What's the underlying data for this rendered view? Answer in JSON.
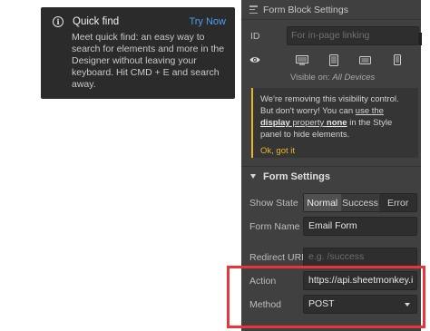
{
  "quick_find": {
    "title": "Quick find",
    "try_now": "Try Now",
    "body": "Meet quick find: an easy way to search for elements and more in the Designer without leaving your keyboard. Hit CMD + E and search away."
  },
  "panel": {
    "header_title": "Form Block Settings",
    "id_label": "ID",
    "id_placeholder": "For in-page linking",
    "visible_on_prefix": "Visible on:",
    "visible_on_value": "All Devices",
    "notice": {
      "text_1": "We're removing this visibility control. But don't worry! You can ",
      "link_1": "use the",
      "link_2": "display",
      "link_3": " property ",
      "link_4": "none",
      "text_2": " in the Style panel to hide elements.",
      "ok": "Ok, got it"
    },
    "form_settings": {
      "title": "Form Settings",
      "show_state_label": "Show State",
      "states": [
        "Normal",
        "Success",
        "Error"
      ],
      "form_name_label": "Form Name",
      "form_name_value": "Email Form",
      "redirect_label": "Redirect URL",
      "redirect_placeholder": "e.g. /success",
      "action_label": "Action",
      "action_value": "https://api.sheetmonkey.i",
      "method_label": "Method",
      "method_value": "POST"
    }
  },
  "colors": {
    "panel_bg": "#404040",
    "accent_warning": "#e7b625",
    "link_blue": "#4a9ff5",
    "highlight_red": "#e8343a"
  },
  "icons": [
    "info-icon",
    "form-icon",
    "eye-icon",
    "desktop-icon",
    "tablet-icon",
    "mobile-landscape-icon",
    "mobile-portrait-icon",
    "dropdown-arrow-icon"
  ]
}
